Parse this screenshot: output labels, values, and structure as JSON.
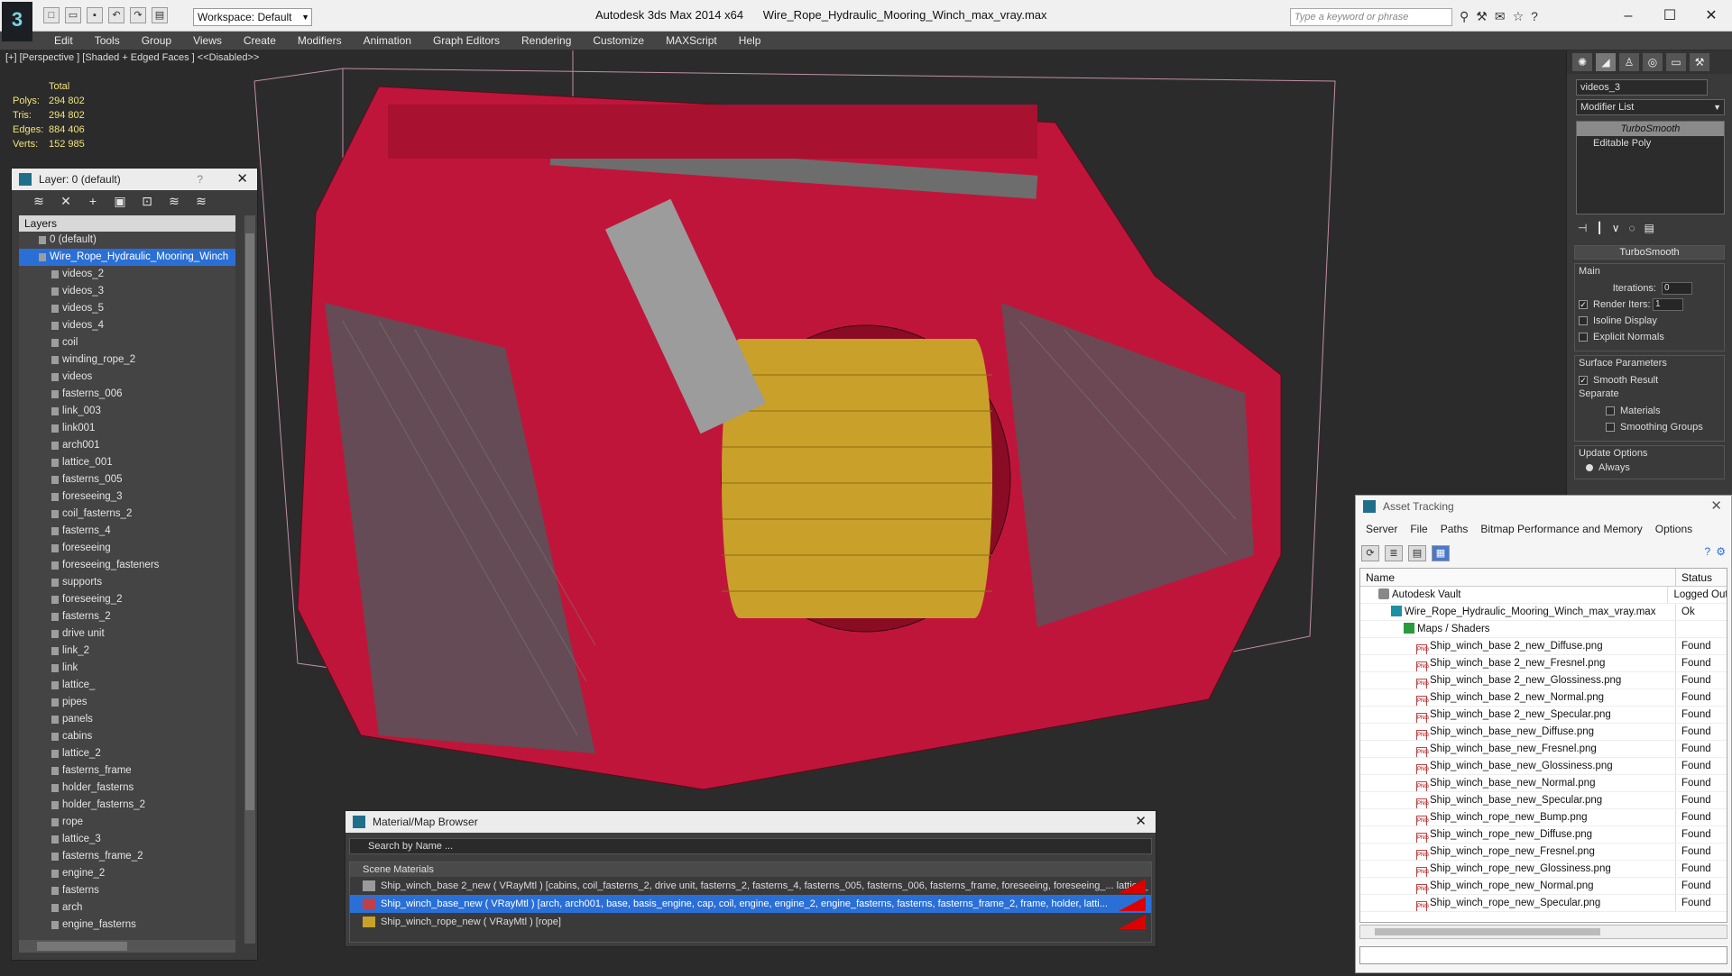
{
  "title_bar": {
    "app_title": "Autodesk 3ds Max  2014 x64",
    "file_name": "Wire_Rope_Hydraulic_Mooring_Winch_max_vray.max",
    "workspace": "Workspace: Default",
    "search_placeholder": "Type a keyword or phrase"
  },
  "menu": [
    "Edit",
    "Tools",
    "Group",
    "Views",
    "Create",
    "Modifiers",
    "Animation",
    "Graph Editors",
    "Rendering",
    "Customize",
    "MAXScript",
    "Help"
  ],
  "viewport": {
    "label": "[+] [Perspective ] [Shaded + Edged Faces ]  <<Disabled>>",
    "stats": {
      "total_label": "Total",
      "polys_label": "Polys:",
      "polys": "294 802",
      "tris_label": "Tris:",
      "tris": "294 802",
      "edges_label": "Edges:",
      "edges": "884 406",
      "verts_label": "Verts:",
      "verts": "152 985"
    }
  },
  "layer_panel": {
    "title": "Layer: 0 (default)",
    "help": "?",
    "header": "Layers",
    "default_layer": "0 (default)",
    "selected_layer": "Wire_Rope_Hydraulic_Mooring_Winch",
    "items": [
      "videos_2",
      "videos_3",
      "videos_5",
      "videos_4",
      "coil",
      "winding_rope_2",
      "videos",
      "fasterns_006",
      "link_003",
      "link001",
      "arch001",
      "lattice_001",
      "fasterns_005",
      "foreseeing_3",
      "coil_fasterns_2",
      "fasterns_4",
      "foreseeing",
      "foreseeing_fasteners",
      "supports",
      "foreseeing_2",
      "fasterns_2",
      "drive unit",
      "link_2",
      "link",
      "lattice_",
      "pipes",
      "panels",
      "cabins",
      "lattice_2",
      "fasterns_frame",
      "holder_fasterns",
      "holder_fasterns_2",
      "rope",
      "lattice_3",
      "fasterns_frame_2",
      "engine_2",
      "fasterns",
      "arch",
      "engine_fasterns"
    ]
  },
  "command_panel": {
    "object_name": "videos_3",
    "modifier_list": "Modifier List",
    "stack": [
      "TurboSmooth",
      "Editable Poly"
    ],
    "rollout": "TurboSmooth",
    "main_label": "Main",
    "iterations_label": "Iterations:",
    "iterations": "0",
    "render_iters_label": "Render Iters:",
    "render_iters": "1",
    "isoline": "Isoline Display",
    "explicit": "Explicit Normals",
    "surface_label": "Surface Parameters",
    "smooth_result": "Smooth Result",
    "separate": "Separate",
    "materials": "Materials",
    "smoothing_groups": "Smoothing Groups",
    "update_label": "Update Options",
    "always": "Always"
  },
  "asset_tracking": {
    "title": "Asset Tracking",
    "menu": [
      "Server",
      "File",
      "Paths",
      "Bitmap Performance and Memory",
      "Options"
    ],
    "col_name": "Name",
    "col_status": "Status",
    "rows": [
      {
        "name": "Autodesk Vault",
        "status": "Logged Out",
        "icon": "vault",
        "indent": 1
      },
      {
        "name": "Wire_Rope_Hydraulic_Mooring_Winch_max_vray.max",
        "status": "Ok",
        "icon": "maxf",
        "indent": 2
      },
      {
        "name": "Maps / Shaders",
        "status": "",
        "icon": "maps",
        "indent": 3
      },
      {
        "name": "Ship_winch_base 2_new_Diffuse.png",
        "status": "Found",
        "icon": "png",
        "indent": 4
      },
      {
        "name": "Ship_winch_base 2_new_Fresnel.png",
        "status": "Found",
        "icon": "png",
        "indent": 4
      },
      {
        "name": "Ship_winch_base 2_new_Glossiness.png",
        "status": "Found",
        "icon": "png",
        "indent": 4
      },
      {
        "name": "Ship_winch_base 2_new_Normal.png",
        "status": "Found",
        "icon": "png",
        "indent": 4
      },
      {
        "name": "Ship_winch_base 2_new_Specular.png",
        "status": "Found",
        "icon": "png",
        "indent": 4
      },
      {
        "name": "Ship_winch_base_new_Diffuse.png",
        "status": "Found",
        "icon": "png",
        "indent": 4
      },
      {
        "name": "Ship_winch_base_new_Fresnel.png",
        "status": "Found",
        "icon": "png",
        "indent": 4
      },
      {
        "name": "Ship_winch_base_new_Glossiness.png",
        "status": "Found",
        "icon": "png",
        "indent": 4
      },
      {
        "name": "Ship_winch_base_new_Normal.png",
        "status": "Found",
        "icon": "png",
        "indent": 4
      },
      {
        "name": "Ship_winch_base_new_Specular.png",
        "status": "Found",
        "icon": "png",
        "indent": 4
      },
      {
        "name": "Ship_winch_rope_new_Bump.png",
        "status": "Found",
        "icon": "png",
        "indent": 4
      },
      {
        "name": "Ship_winch_rope_new_Diffuse.png",
        "status": "Found",
        "icon": "png",
        "indent": 4
      },
      {
        "name": "Ship_winch_rope_new_Fresnel.png",
        "status": "Found",
        "icon": "png",
        "indent": 4
      },
      {
        "name": "Ship_winch_rope_new_Glossiness.png",
        "status": "Found",
        "icon": "png",
        "indent": 4
      },
      {
        "name": "Ship_winch_rope_new_Normal.png",
        "status": "Found",
        "icon": "png",
        "indent": 4
      },
      {
        "name": "Ship_winch_rope_new_Specular.png",
        "status": "Found",
        "icon": "png",
        "indent": 4
      }
    ]
  },
  "material_browser": {
    "title": "Material/Map Browser",
    "search": "Search by Name ...",
    "section": "Scene Materials",
    "items": [
      "Ship_winch_base 2_new ( VRayMtl ) [cabins, coil_fasterns_2, drive unit, fasterns_2, fasterns_4, fasterns_005, fasterns_006, fasterns_frame, foreseeing, foreseeing_... lattice_",
      "Ship_winch_base_new ( VRayMtl ) [arch, arch001, base, basis_engine, cap, coil, engine, engine_2, engine_fasterns, fasterns, fasterns_frame_2, frame, holder, latti...",
      "Ship_winch_rope_new ( VRayMtl ) [rope]"
    ]
  },
  "colors": {
    "model_red": "#c8102e",
    "rope_yellow": "#c9a12a",
    "selection_blue": "#2a6fd6",
    "stats_yellow": "#f2e37a"
  }
}
